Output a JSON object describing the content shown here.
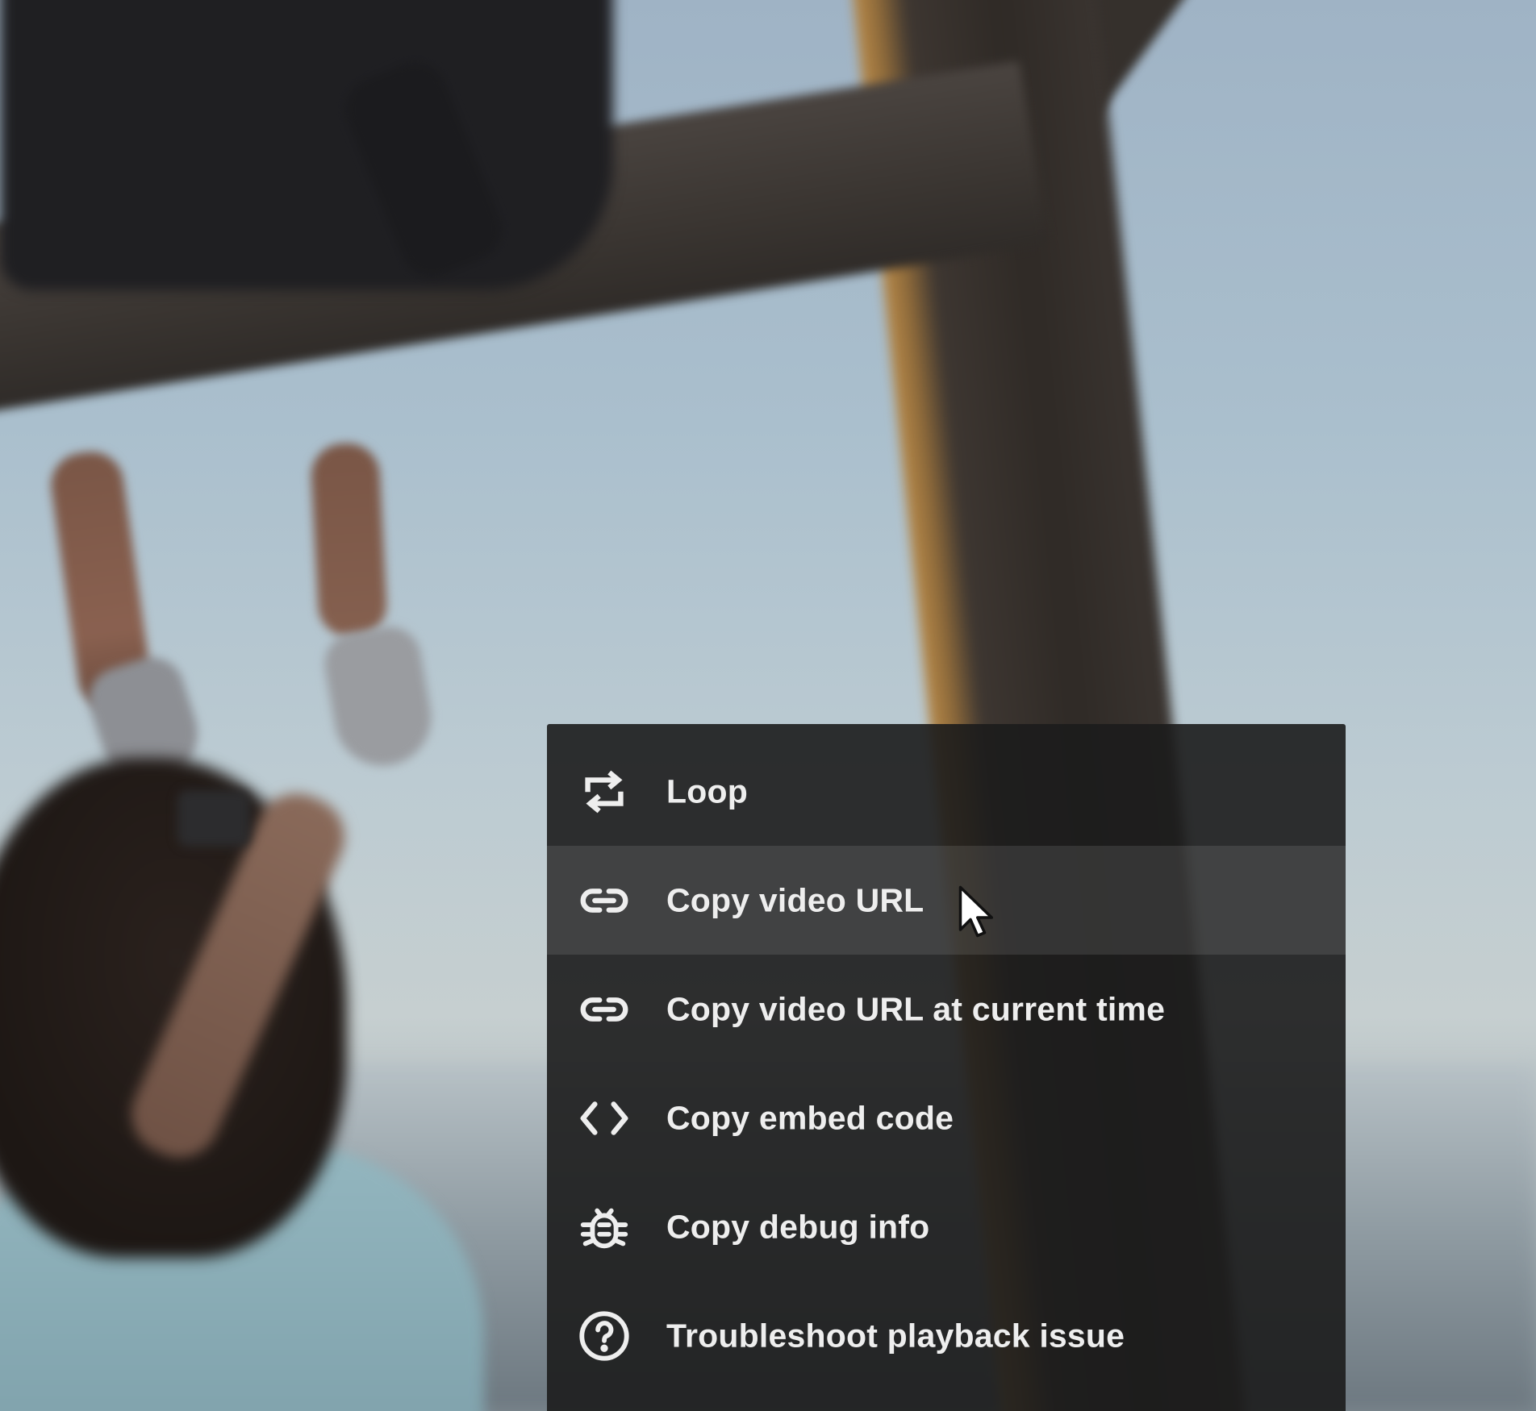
{
  "video": {
    "scene": "video-frame"
  },
  "context_menu": {
    "items": [
      {
        "label": "Loop",
        "icon": "loop-icon",
        "highlighted": false
      },
      {
        "label": "Copy video URL",
        "icon": "link-icon",
        "highlighted": true
      },
      {
        "label": "Copy video URL at current time",
        "icon": "link-icon",
        "highlighted": false
      },
      {
        "label": "Copy embed code",
        "icon": "code-icon",
        "highlighted": false
      },
      {
        "label": "Copy debug info",
        "icon": "bug-icon",
        "highlighted": false
      },
      {
        "label": "Troubleshoot playback issue",
        "icon": "help-circle-icon",
        "highlighted": false
      }
    ],
    "colors": {
      "background": "#1c1c1c",
      "text": "#eeeeee",
      "highlight": "#3a3a3a"
    }
  },
  "cursor": {
    "icon": "mouse-pointer-icon"
  }
}
